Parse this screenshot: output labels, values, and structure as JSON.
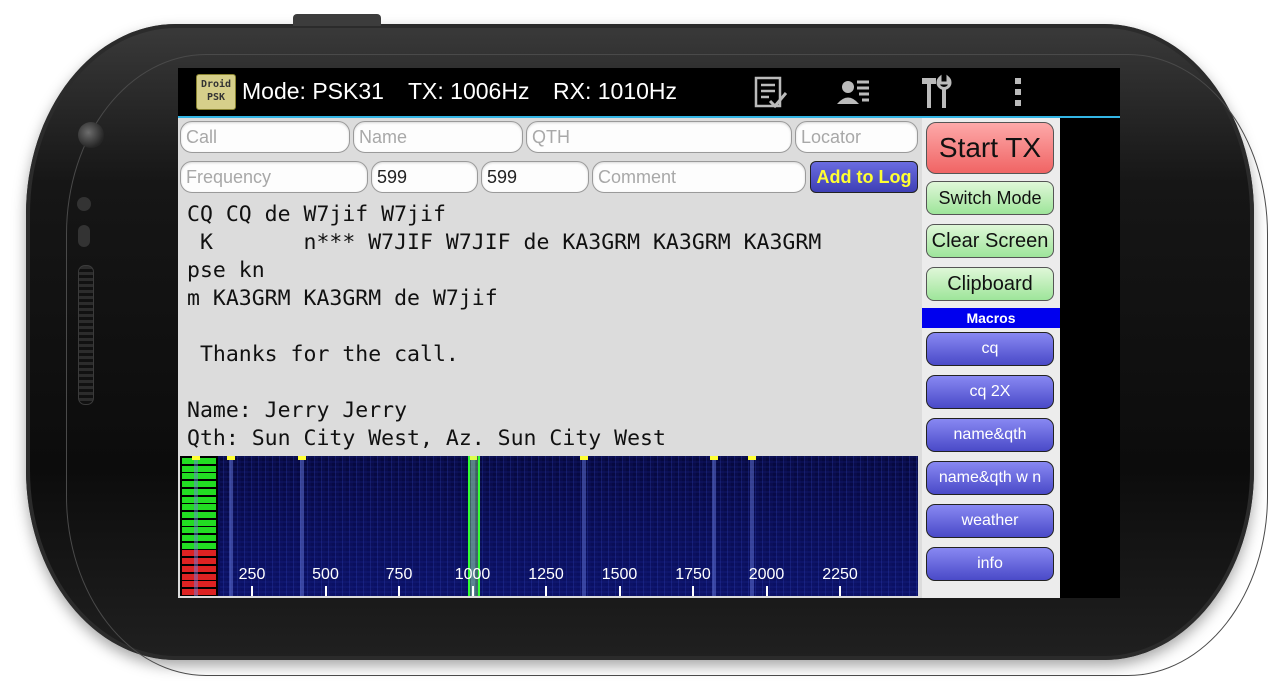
{
  "app": {
    "logo_line1": "Droid",
    "logo_line2": "PSK",
    "mode": "Mode: PSK31",
    "tx": "TX: 1006Hz",
    "rx": "RX: 1010Hz"
  },
  "actionbar_icons": [
    "log-checklist-icon",
    "contact-card-icon",
    "tools-icon",
    "overflow-menu-icon"
  ],
  "form": {
    "call_placeholder": "Call",
    "name_placeholder": "Name",
    "qth_placeholder": "QTH",
    "locator_placeholder": "Locator",
    "frequency_placeholder": "Frequency",
    "rst_sent": "599",
    "rst_received": "599",
    "comment_placeholder": "Comment",
    "add_to_log_label": "Add to Log"
  },
  "rx_text": [
    "CQ CQ de W7jif W7jif",
    " K       n*** W7JIF W7JIF de KA3GRM KA3GRM KA3GRM",
    "pse kn",
    "m KA3GRM KA3GRM de W7jif",
    "",
    " Thanks for the call.",
    "",
    "Name: Jerry Jerry",
    "Qth: Sun City West, Az. Sun City West"
  ],
  "waterfall": {
    "tick_labels": [
      "250",
      "500",
      "750",
      "1000",
      "1250",
      "1500",
      "1750",
      "2000",
      "2250"
    ],
    "tick_values": [
      250,
      500,
      750,
      1000,
      1250,
      1500,
      1750,
      2000,
      2250
    ],
    "cursor_hz": 1006,
    "signal_marks_hz": [
      60,
      180,
      420,
      1000,
      1380,
      1820,
      1950
    ],
    "level_green_segments": 12,
    "level_red_segments": 6
  },
  "controls": {
    "start_tx_label": "Start TX",
    "switch_mode_label": "Switch Mode",
    "clear_screen_label": "Clear Screen",
    "clipboard_label": "Clipboard",
    "macros_heading": "Macros",
    "macros": [
      "cq",
      "cq 2X",
      "name&qth",
      "name&qth w n",
      "weather",
      "info"
    ]
  },
  "colors": {
    "accent_blue_line": "#33b5e5",
    "add_to_log_text": "#ffff33",
    "start_tx_bg": "#f06464",
    "green_button_bg": "#9ee59a",
    "macro_button_bg": "#4a4ac8",
    "waterfall_cursor": "#33ff33"
  }
}
